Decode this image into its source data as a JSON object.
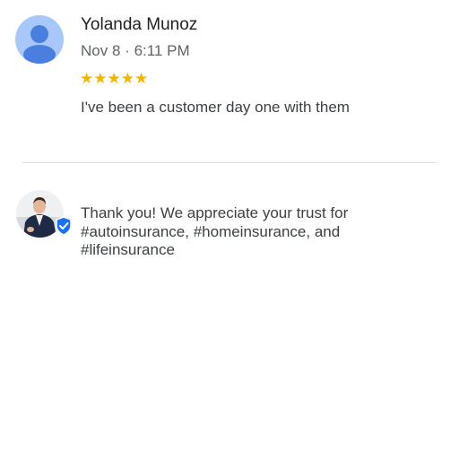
{
  "review": {
    "author": "Yolanda Munoz",
    "date": "Nov 8",
    "separator": "·",
    "time": "6:11 PM",
    "rating": 5,
    "stars": "★★★★★",
    "text": "I've been a customer day one with them",
    "avatar_icon": "person-icon"
  },
  "reply": {
    "lines": [
      "Thank you! We appreciate your trust for",
      "#autoinsurance, #homeinsurance, and",
      "#lifeinsurance"
    ],
    "badge_icon": "verified-check-icon"
  },
  "colors": {
    "star": "#f2b600",
    "avatar_bg": "#a8c7fa",
    "avatar_fg": "#4a7fe0",
    "badge": "#1a73e8"
  }
}
